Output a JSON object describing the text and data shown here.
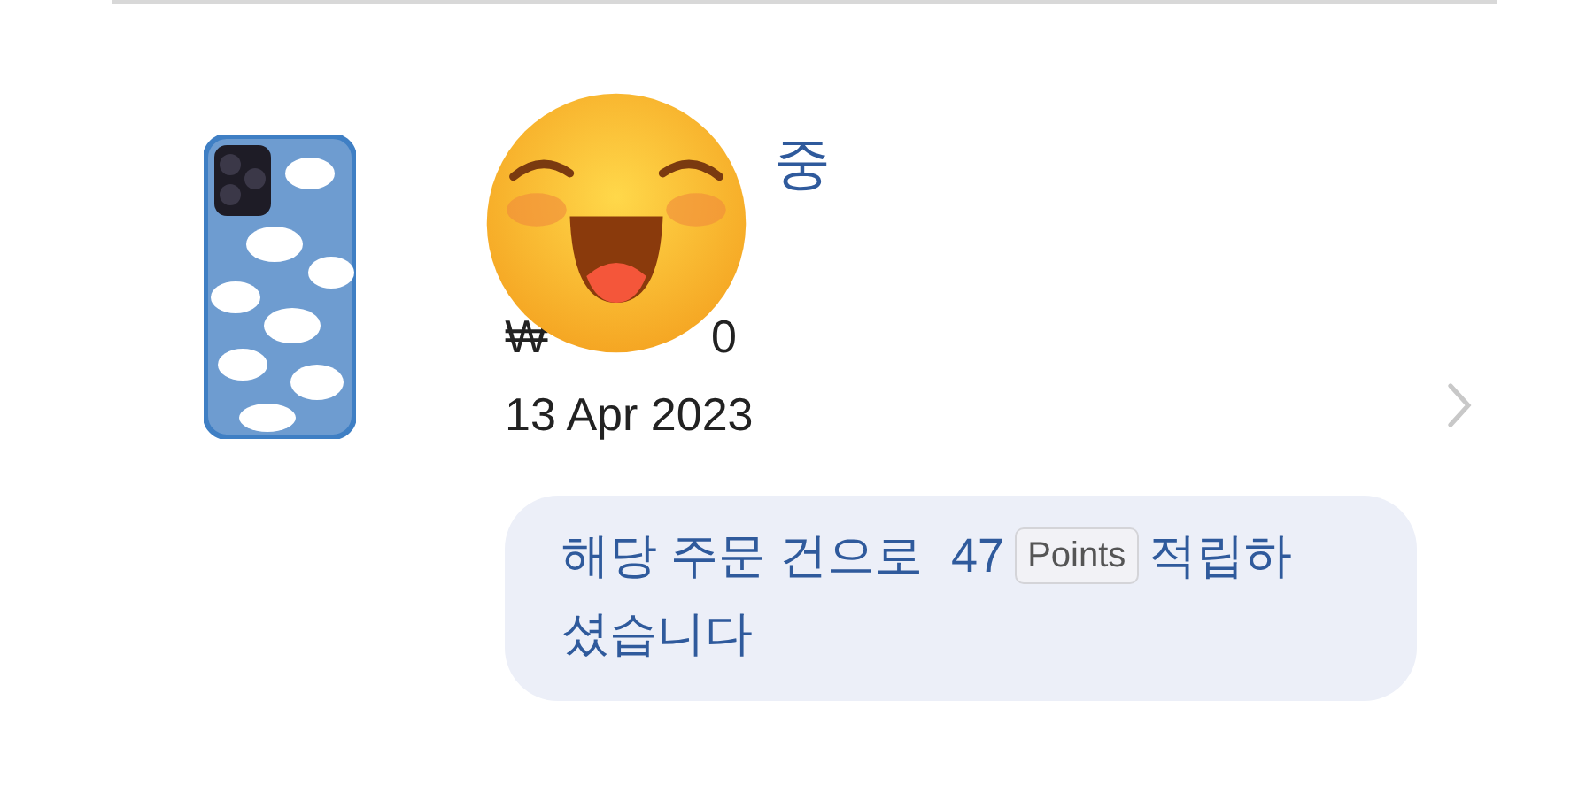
{
  "order": {
    "status": "중",
    "price_start": "₩",
    "price_end": "0",
    "date": "13 Apr 2023"
  },
  "points_notice": {
    "before": "해당 주문 건으로",
    "amount": "47",
    "unit": "Points",
    "after": [
      "적립하",
      "셨습니다"
    ]
  }
}
